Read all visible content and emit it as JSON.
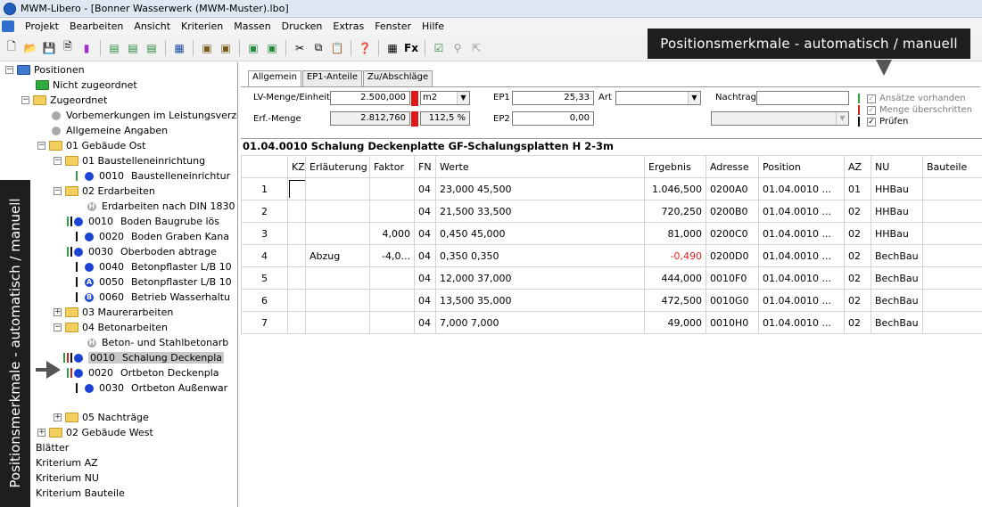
{
  "window": {
    "title": "MWM-Libero - [Bonner Wasserwerk (MWM-Muster).lbo]"
  },
  "menu": [
    "Projekt",
    "Bearbeiten",
    "Ansicht",
    "Kriterien",
    "Massen",
    "Drucken",
    "Extras",
    "Fenster",
    "Hilfe"
  ],
  "banners": {
    "top": "Positionsmerkmale - automatisch / manuell",
    "left": "Positionsmerkmale - automatisch / manuell"
  },
  "tree": {
    "positionen": "Positionen",
    "nicht_zugeordnet": "Nicht zugeordnet",
    "zugeordnet": "Zugeordnet",
    "vorbemerkungen": "Vorbemerkungen im Leistungsverze",
    "allgemeine": "Allgemeine Angaben",
    "geb_ost": "01 Gebäude Ost",
    "baustelle": "01 Baustelleneinrichtung",
    "baustelle_0010_num": "0010",
    "baustelle_0010": "Baustelleneinrichtur",
    "erdarbeiten": "02 Erdarbeiten",
    "erd_din": "Erdarbeiten nach DIN 1830",
    "erd_0010_num": "0010",
    "erd_0010": "Boden Baugrube lös",
    "erd_0020_num": "0020",
    "erd_0020": "Boden Graben Kana",
    "erd_0030_num": "0030",
    "erd_0030": "Oberboden abtrage",
    "erd_0040_num": "0040",
    "erd_0040": "Betonpflaster L/B 10",
    "erd_0050_num": "0050",
    "erd_0050": "Betonpflaster L/B 10",
    "erd_0060_num": "0060",
    "erd_0060": "Betrieb Wasserhaltu",
    "maurer": "03 Maurerarbeiten",
    "beton": "04 Betonarbeiten",
    "beton_stahl": "Beton- und Stahlbetonarb",
    "bet_0010_num": "0010",
    "bet_0010": "Schalung Deckenpla",
    "bet_0020_num": "0020",
    "bet_0020": "Ortbeton Deckenpla",
    "bet_0030_num": "0030",
    "bet_0030": "Ortbeton Außenwar",
    "nachtraege": "05 Nachträge",
    "geb_west": "02 Gebäude West",
    "blaetter": "Blätter",
    "krit_az": "Kriterium AZ",
    "krit_nu": "Kriterium NU",
    "krit_bauteile": "Kriterium Bauteile"
  },
  "tabs": [
    "Allgemein",
    "EP1-Anteile",
    "Zu/Abschläge"
  ],
  "form": {
    "lv_label": "LV-Menge/Einheit",
    "lv_value": "2.500,000",
    "unit": "m2",
    "erf_label": "Erf.-Menge",
    "erf_value": "2.812,760",
    "erf_percent": "112,5 %",
    "ep1_label": "EP1",
    "ep1_value": "25,33",
    "ep2_label": "EP2",
    "ep2_value": "0,00",
    "art_label": "Art",
    "nachtrag_label": "Nachtrag",
    "cb1": "Ansätze vorhanden",
    "cb2": "Menge überschritten",
    "cb3": "Prüfen"
  },
  "position_header": "01.04.0010  Schalung Deckenplatte GF-Schalungsplatten H 2-3m",
  "grid": {
    "columns": [
      "",
      "KZ",
      "Erläuterung",
      "Faktor",
      "FN",
      "Werte",
      "Ergebnis",
      "Adresse",
      "Position",
      "AZ",
      "NU",
      "Bauteile"
    ],
    "rows": [
      {
        "no": "1",
        "kz": "",
        "erl": "",
        "faktor": "",
        "fn": "04",
        "werte": "23,000 45,500",
        "ergebnis": "1.046,500",
        "adresse": "0200A0",
        "position": "01.04.0010   ...",
        "az": "01",
        "nu": "HHBau",
        "bauteile": ""
      },
      {
        "no": "2",
        "kz": "",
        "erl": "",
        "faktor": "",
        "fn": "04",
        "werte": "21,500 33,500",
        "ergebnis": "720,250",
        "adresse": "0200B0",
        "position": "01.04.0010   ...",
        "az": "02",
        "nu": "HHBau",
        "bauteile": ""
      },
      {
        "no": "3",
        "kz": "",
        "erl": "",
        "faktor": "4,000",
        "fn": "04",
        "werte": "0,450 45,000",
        "ergebnis": "81,000",
        "adresse": "0200C0",
        "position": "01.04.0010   ...",
        "az": "02",
        "nu": "HHBau",
        "bauteile": ""
      },
      {
        "no": "4",
        "kz": "",
        "erl": "Abzug",
        "faktor": "-4,0...",
        "fn": "04",
        "werte": "0,350 0,350",
        "ergebnis": "-0,490",
        "adresse": "0200D0",
        "position": "01.04.0010   ...",
        "az": "02",
        "nu": "BechBau",
        "bauteile": ""
      },
      {
        "no": "5",
        "kz": "",
        "erl": "",
        "faktor": "",
        "fn": "04",
        "werte": "12,000 37,000",
        "ergebnis": "444,000",
        "adresse": "0010F0",
        "position": "01.04.0010   ...",
        "az": "02",
        "nu": "BechBau",
        "bauteile": ""
      },
      {
        "no": "6",
        "kz": "",
        "erl": "",
        "faktor": "",
        "fn": "04",
        "werte": "13,500 35,000",
        "ergebnis": "472,500",
        "adresse": "0010G0",
        "position": "01.04.0010   ...",
        "az": "02",
        "nu": "BechBau",
        "bauteile": ""
      },
      {
        "no": "7",
        "kz": "",
        "erl": "",
        "faktor": "",
        "fn": "04",
        "werte": "7,000 7,000",
        "ergebnis": "49,000",
        "adresse": "0010H0",
        "position": "01.04.0010   ...",
        "az": "02",
        "nu": "BechBau",
        "bauteile": ""
      }
    ]
  }
}
